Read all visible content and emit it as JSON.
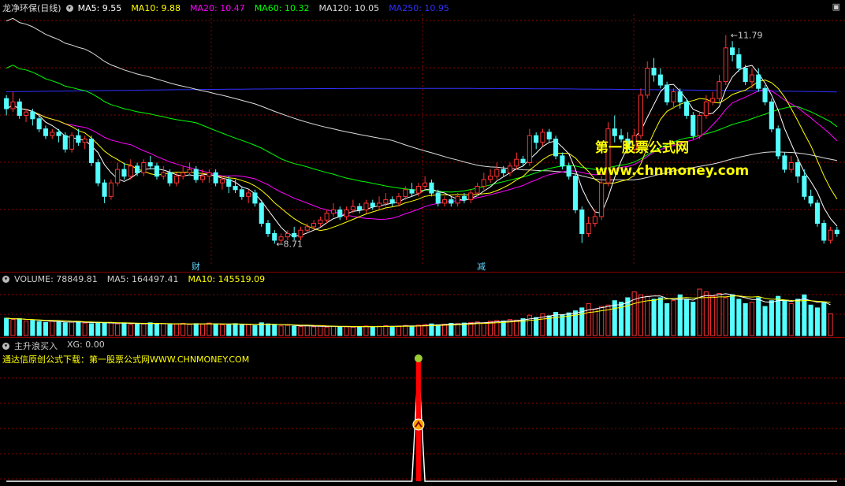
{
  "main": {
    "title": "龙净环保(日线)",
    "ma_labels": [
      {
        "text": "MA5: 9.55",
        "color": "#ffffff"
      },
      {
        "text": "MA10: 9.88",
        "color": "#ffff00"
      },
      {
        "text": "MA20: 10.47",
        "color": "#ff00ff"
      },
      {
        "text": "MA60: 10.32",
        "color": "#00ff00"
      },
      {
        "text": "MA120: 10.05",
        "color": "#dddddd"
      },
      {
        "text": "MA250: 10.95",
        "color": "#3030ff"
      }
    ],
    "high_label": "11.79",
    "low_label": "8.71",
    "marker_cai": "财",
    "marker_jian": "减",
    "watermark_title": "第一股票公式网",
    "watermark_url": "www.chnmoney.com"
  },
  "volume": {
    "labels": [
      {
        "text": "VOLUME: 78849.81",
        "color": "#cccccc"
      },
      {
        "text": "MA5: 164497.41",
        "color": "#cccccc"
      },
      {
        "text": "MA10: 145519.09",
        "color": "#ffff00"
      }
    ]
  },
  "indicator": {
    "labels": [
      {
        "text": "主升浪买入",
        "color": "#cccccc"
      },
      {
        "text": "XG: 0.00",
        "color": "#cccccc"
      }
    ],
    "download_text": "通达信原创公式下载：第一股票公式网WWW.CHNMONEY.COM"
  },
  "colors": {
    "up": "#ff3232",
    "down": "#54ffff",
    "grid": "#8b0000"
  },
  "chart_data": [
    {
      "type": "candlestick",
      "title": "龙净环保(日线)",
      "y_range": [
        8.4,
        12.1
      ],
      "high": 11.79,
      "low": 8.71,
      "candles": [
        [
          10.85,
          10.7,
          10.9,
          10.6
        ],
        [
          10.7,
          10.8,
          10.95,
          10.65
        ],
        [
          10.8,
          10.6,
          10.85,
          10.55
        ],
        [
          10.6,
          10.65,
          10.7,
          10.5
        ],
        [
          10.65,
          10.55,
          10.7,
          10.45
        ],
        [
          10.55,
          10.4,
          10.6,
          10.35
        ],
        [
          10.4,
          10.3,
          10.45,
          10.25
        ],
        [
          10.3,
          10.35,
          10.4,
          10.25
        ],
        [
          10.35,
          10.3,
          10.4,
          10.2
        ],
        [
          10.3,
          10.1,
          10.35,
          10.05
        ],
        [
          10.1,
          10.3,
          10.35,
          10.05
        ],
        [
          10.3,
          10.2,
          10.4,
          10.15
        ],
        [
          10.2,
          10.25,
          10.3,
          10.1
        ],
        [
          10.25,
          9.9,
          10.3,
          9.85
        ],
        [
          9.9,
          9.6,
          9.95,
          9.55
        ],
        [
          9.6,
          9.4,
          9.65,
          9.3
        ],
        [
          9.4,
          9.6,
          9.65,
          9.35
        ],
        [
          9.6,
          9.8,
          9.9,
          9.55
        ],
        [
          9.8,
          9.7,
          9.9,
          9.65
        ],
        [
          9.7,
          9.85,
          9.95,
          9.65
        ],
        [
          9.85,
          9.75,
          9.9,
          9.7
        ],
        [
          9.75,
          9.9,
          9.95,
          9.7
        ],
        [
          9.9,
          9.85,
          10.0,
          9.8
        ],
        [
          9.85,
          9.7,
          9.9,
          9.65
        ],
        [
          9.7,
          9.75,
          9.85,
          9.65
        ],
        [
          9.75,
          9.6,
          9.8,
          9.55
        ],
        [
          9.6,
          9.7,
          9.75,
          9.55
        ],
        [
          9.7,
          9.75,
          9.85,
          9.65
        ],
        [
          9.75,
          9.8,
          9.9,
          9.7
        ],
        [
          9.8,
          9.65,
          9.85,
          9.6
        ],
        [
          9.65,
          9.7,
          9.8,
          9.6
        ],
        [
          9.7,
          9.75,
          9.8,
          9.6
        ],
        [
          9.75,
          9.6,
          9.8,
          9.55
        ],
        [
          9.6,
          9.65,
          9.7,
          9.5
        ],
        [
          9.65,
          9.55,
          9.7,
          9.45
        ],
        [
          9.55,
          9.5,
          9.65,
          9.45
        ],
        [
          9.5,
          9.4,
          9.55,
          9.35
        ],
        [
          9.4,
          9.45,
          9.5,
          9.3
        ],
        [
          9.45,
          9.3,
          9.5,
          9.25
        ],
        [
          9.3,
          9.0,
          9.35,
          8.95
        ],
        [
          9.0,
          8.85,
          9.05,
          8.8
        ],
        [
          8.85,
          8.75,
          8.9,
          8.7
        ],
        [
          8.75,
          8.8,
          8.85,
          8.7
        ],
        [
          8.8,
          8.85,
          8.9,
          8.75
        ],
        [
          8.85,
          8.8,
          8.95,
          8.75
        ],
        [
          8.8,
          8.9,
          8.95,
          8.75
        ],
        [
          8.9,
          8.95,
          9.0,
          8.85
        ],
        [
          8.95,
          9.0,
          9.05,
          8.9
        ],
        [
          9.0,
          9.05,
          9.1,
          8.95
        ],
        [
          9.05,
          9.15,
          9.2,
          9.0
        ],
        [
          9.15,
          9.2,
          9.3,
          9.1
        ],
        [
          9.2,
          9.1,
          9.25,
          9.05
        ],
        [
          9.1,
          9.2,
          9.25,
          9.05
        ],
        [
          9.2,
          9.25,
          9.35,
          9.15
        ],
        [
          9.25,
          9.2,
          9.3,
          9.15
        ],
        [
          9.2,
          9.3,
          9.35,
          9.15
        ],
        [
          9.3,
          9.25,
          9.35,
          9.2
        ],
        [
          9.25,
          9.3,
          9.4,
          9.2
        ],
        [
          9.3,
          9.35,
          9.45,
          9.25
        ],
        [
          9.35,
          9.3,
          9.4,
          9.25
        ],
        [
          9.3,
          9.4,
          9.45,
          9.25
        ],
        [
          9.4,
          9.5,
          9.55,
          9.35
        ],
        [
          9.5,
          9.45,
          9.6,
          9.4
        ],
        [
          9.45,
          9.55,
          9.6,
          9.4
        ],
        [
          9.55,
          9.6,
          9.7,
          9.5
        ],
        [
          9.6,
          9.45,
          9.65,
          9.4
        ],
        [
          9.45,
          9.3,
          9.5,
          9.25
        ],
        [
          9.3,
          9.35,
          9.4,
          9.25
        ],
        [
          9.35,
          9.3,
          9.4,
          9.25
        ],
        [
          9.3,
          9.4,
          9.45,
          9.25
        ],
        [
          9.4,
          9.35,
          9.45,
          9.3
        ],
        [
          9.35,
          9.45,
          9.5,
          9.3
        ],
        [
          9.45,
          9.55,
          9.6,
          9.4
        ],
        [
          9.55,
          9.65,
          9.75,
          9.5
        ],
        [
          9.65,
          9.7,
          9.8,
          9.6
        ],
        [
          9.7,
          9.8,
          9.9,
          9.65
        ],
        [
          9.8,
          9.75,
          9.85,
          9.7
        ],
        [
          9.75,
          9.85,
          9.9,
          9.7
        ],
        [
          9.85,
          9.95,
          10.05,
          9.8
        ],
        [
          9.95,
          9.9,
          10.0,
          9.85
        ],
        [
          9.9,
          10.3,
          10.4,
          9.85
        ],
        [
          10.3,
          10.2,
          10.35,
          10.1
        ],
        [
          10.2,
          10.35,
          10.4,
          10.15
        ],
        [
          10.35,
          10.25,
          10.4,
          10.2
        ],
        [
          10.25,
          10.0,
          10.3,
          9.95
        ],
        [
          10.0,
          9.85,
          10.05,
          9.8
        ],
        [
          9.85,
          9.7,
          9.9,
          9.65
        ],
        [
          9.7,
          9.2,
          9.75,
          9.15
        ],
        [
          9.2,
          8.85,
          9.25,
          8.71
        ],
        [
          8.85,
          9.0,
          9.1,
          8.8
        ],
        [
          9.0,
          9.1,
          9.2,
          8.95
        ],
        [
          9.1,
          9.6,
          9.7,
          9.05
        ],
        [
          9.6,
          10.4,
          10.5,
          9.55
        ],
        [
          10.4,
          10.3,
          10.6,
          10.2
        ],
        [
          10.3,
          10.25,
          10.4,
          10.2
        ],
        [
          10.25,
          10.1,
          10.35,
          10.05
        ],
        [
          10.1,
          10.3,
          10.4,
          10.05
        ],
        [
          10.3,
          10.9,
          11.0,
          10.25
        ],
        [
          10.9,
          11.3,
          11.4,
          10.85
        ],
        [
          11.3,
          11.2,
          11.45,
          11.1
        ],
        [
          11.2,
          11.05,
          11.3,
          11.0
        ],
        [
          11.05,
          10.8,
          11.1,
          10.75
        ],
        [
          10.8,
          10.95,
          11.0,
          10.7
        ],
        [
          10.95,
          10.8,
          11.0,
          10.7
        ],
        [
          10.8,
          10.6,
          10.85,
          10.55
        ],
        [
          10.6,
          10.3,
          10.65,
          10.25
        ],
        [
          10.3,
          10.6,
          10.65,
          10.25
        ],
        [
          10.6,
          10.8,
          10.9,
          10.55
        ],
        [
          10.8,
          10.85,
          10.95,
          10.75
        ],
        [
          10.85,
          11.1,
          11.2,
          10.8
        ],
        [
          11.1,
          11.6,
          11.79,
          11.05
        ],
        [
          11.6,
          11.5,
          11.7,
          11.4
        ],
        [
          11.5,
          11.3,
          11.6,
          11.25
        ],
        [
          11.3,
          11.1,
          11.35,
          11.05
        ],
        [
          11.1,
          11.2,
          11.3,
          11.0
        ],
        [
          11.2,
          11.0,
          11.3,
          10.95
        ],
        [
          11.0,
          10.8,
          11.05,
          10.75
        ],
        [
          10.8,
          10.4,
          10.85,
          10.35
        ],
        [
          10.4,
          10.0,
          10.45,
          9.95
        ],
        [
          10.0,
          9.8,
          10.05,
          9.75
        ],
        [
          9.8,
          9.9,
          10.0,
          9.75
        ],
        [
          9.9,
          9.7,
          9.95,
          9.6
        ],
        [
          9.7,
          9.4,
          9.8,
          9.35
        ],
        [
          9.4,
          9.3,
          9.5,
          9.25
        ],
        [
          9.3,
          9.0,
          9.35,
          8.95
        ],
        [
          9.0,
          8.75,
          9.05,
          8.7
        ],
        [
          8.75,
          8.9,
          8.95,
          8.7
        ],
        [
          8.9,
          8.85,
          8.95,
          8.8
        ]
      ]
    },
    {
      "type": "bar",
      "title": "VOLUME",
      "values": [
        60,
        55,
        58,
        50,
        52,
        48,
        45,
        50,
        47,
        44,
        46,
        49,
        43,
        41,
        46,
        42,
        45,
        40,
        43,
        38,
        42,
        40,
        44,
        39,
        41,
        37,
        40,
        42,
        38,
        41,
        39,
        43,
        40,
        37,
        39,
        41,
        36,
        38,
        34,
        44,
        40,
        36,
        33,
        35,
        32,
        31,
        34,
        30,
        33,
        29,
        32,
        31,
        30,
        29,
        31,
        33,
        30,
        32,
        34,
        31,
        33,
        35,
        32,
        36,
        38,
        40,
        37,
        39,
        42,
        41,
        43,
        45,
        47,
        44,
        49,
        52,
        50,
        55,
        53,
        58,
        70,
        62,
        75,
        68,
        80,
        72,
        78,
        85,
        95,
        110,
        90,
        100,
        105,
        120,
        115,
        130,
        150,
        140,
        135,
        125,
        130,
        110,
        120,
        140,
        125,
        115,
        160,
        150,
        135,
        145,
        130,
        140,
        125,
        110,
        115,
        130,
        100,
        120,
        135,
        120,
        110,
        125,
        140,
        105,
        95,
        115,
        75
      ],
      "ma5": 164497.41,
      "ma10": 145519.09
    },
    {
      "type": "line",
      "title": "主升浪买入",
      "series": [
        {
          "name": "XG",
          "values": [
            0,
            0,
            0,
            0,
            0,
            0,
            0,
            0,
            0,
            0,
            0,
            0,
            0,
            0,
            0,
            0,
            0,
            0,
            0,
            0,
            0,
            0,
            0,
            0,
            0,
            0,
            0,
            0,
            0,
            0,
            0,
            0,
            0,
            0,
            0,
            0,
            0,
            0,
            0,
            0,
            0,
            0,
            0,
            0,
            0,
            0,
            0,
            0,
            0,
            0,
            0,
            0,
            0,
            0,
            0,
            0,
            0,
            0,
            0,
            0,
            0,
            0,
            0,
            1,
            0,
            0,
            0,
            0,
            0,
            0,
            0,
            0,
            0,
            0,
            0,
            0,
            0,
            0,
            0,
            0,
            0,
            0,
            0,
            0,
            0,
            0,
            0,
            0,
            0,
            0,
            0,
            0,
            0,
            0,
            0,
            0,
            0,
            0,
            0,
            0,
            0,
            0,
            0,
            0,
            0,
            0,
            0,
            0,
            0,
            0,
            0,
            0,
            0,
            0,
            0,
            0,
            0,
            0,
            0,
            0,
            0,
            0,
            0,
            0,
            0,
            0,
            0,
            0
          ]
        }
      ],
      "current": 0.0
    }
  ]
}
